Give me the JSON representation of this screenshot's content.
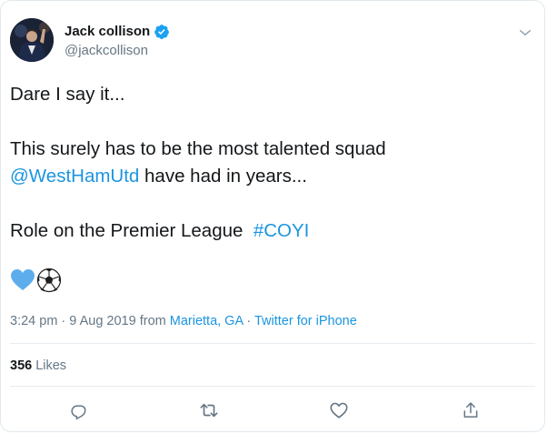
{
  "tweet": {
    "author": {
      "display_name": "Jack collison",
      "handle": "@jackcollison",
      "verified": true
    },
    "text": {
      "line1": "Dare I say it...",
      "line2": "This surely has to be the most talented squad",
      "line3_mention": "@WestHamUtd",
      "line3_rest": " have had in years...",
      "line4_text": "Role on the Premier League  ",
      "line4_hashtag": "#COYI"
    },
    "emojis": [
      "blue-heart",
      "soccer-ball"
    ],
    "meta": {
      "time": "3:24 pm",
      "sep1": " · ",
      "date": "9 Aug 2019",
      "from_label": " from ",
      "location": "Marietta, GA",
      "sep2": " · ",
      "source": "Twitter for iPhone"
    },
    "likes": {
      "count": "356",
      "label": "Likes"
    },
    "actions": [
      "reply",
      "retweet",
      "like",
      "share"
    ]
  },
  "colors": {
    "link": "#1b95e0",
    "secondary_text": "#657786",
    "primary_text": "#14171a",
    "border": "#e1e8ed"
  }
}
